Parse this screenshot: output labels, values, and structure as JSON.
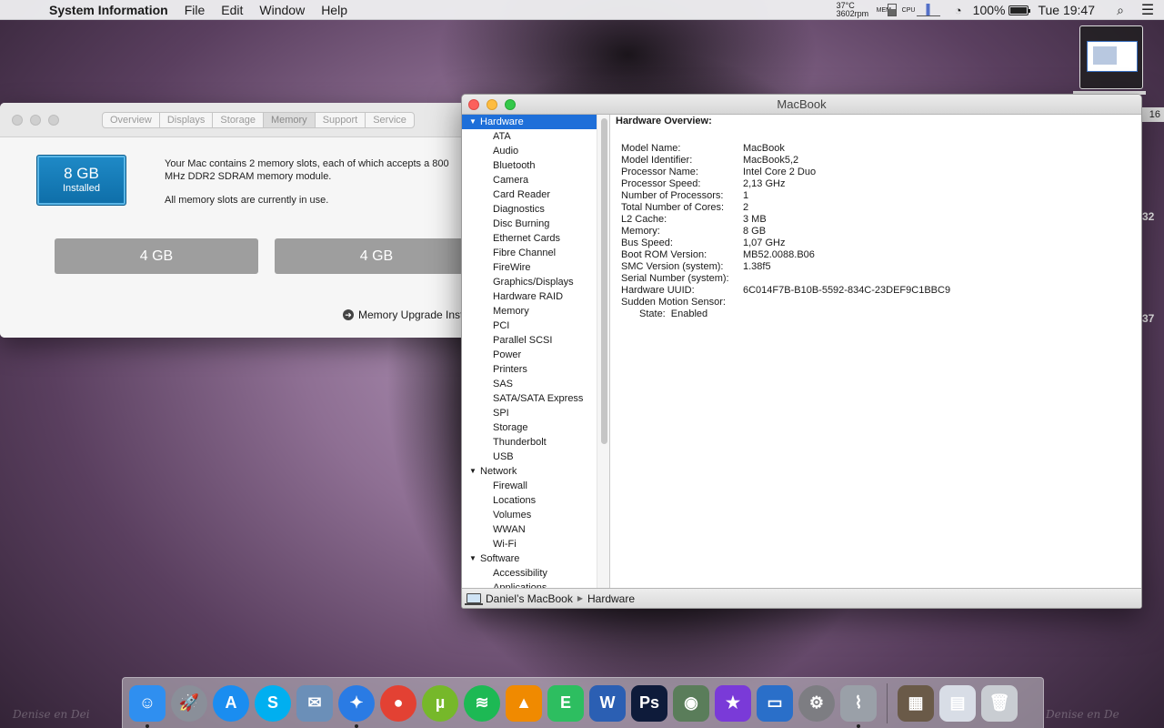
{
  "menubar": {
    "apple": "",
    "app_name": "System Information",
    "menus": [
      "File",
      "Edit",
      "Window",
      "Help"
    ],
    "temperature": "37°C",
    "rpm": "3602rpm",
    "mem_label": "MEM",
    "cpu_label": "CPU",
    "battery_percent": "100%",
    "battery_level": 1.0,
    "clock": "Tue 19:47"
  },
  "about_window": {
    "tabs": [
      "Overview",
      "Displays",
      "Storage",
      "Memory",
      "Support",
      "Service"
    ],
    "active_tab": "Memory",
    "installed_size": "8 GB",
    "installed_label": "Installed",
    "description": "Your Mac contains 2 memory slots, each of which accepts a 800 MHz DDR2 SDRAM memory module.",
    "slots_note": "All memory slots are currently in use.",
    "slots": [
      "4 GB",
      "4 GB"
    ],
    "upgrade_link": "Memory Upgrade Inst"
  },
  "si_window": {
    "title": "MacBook",
    "sidebar": [
      {
        "type": "group",
        "label": "Hardware",
        "selected": true
      },
      {
        "type": "item",
        "label": "ATA"
      },
      {
        "type": "item",
        "label": "Audio"
      },
      {
        "type": "item",
        "label": "Bluetooth"
      },
      {
        "type": "item",
        "label": "Camera"
      },
      {
        "type": "item",
        "label": "Card Reader"
      },
      {
        "type": "item",
        "label": "Diagnostics"
      },
      {
        "type": "item",
        "label": "Disc Burning"
      },
      {
        "type": "item",
        "label": "Ethernet Cards"
      },
      {
        "type": "item",
        "label": "Fibre Channel"
      },
      {
        "type": "item",
        "label": "FireWire"
      },
      {
        "type": "item",
        "label": "Graphics/Displays"
      },
      {
        "type": "item",
        "label": "Hardware RAID"
      },
      {
        "type": "item",
        "label": "Memory"
      },
      {
        "type": "item",
        "label": "PCI"
      },
      {
        "type": "item",
        "label": "Parallel SCSI"
      },
      {
        "type": "item",
        "label": "Power"
      },
      {
        "type": "item",
        "label": "Printers"
      },
      {
        "type": "item",
        "label": "SAS"
      },
      {
        "type": "item",
        "label": "SATA/SATA Express"
      },
      {
        "type": "item",
        "label": "SPI"
      },
      {
        "type": "item",
        "label": "Storage"
      },
      {
        "type": "item",
        "label": "Thunderbolt"
      },
      {
        "type": "item",
        "label": "USB"
      },
      {
        "type": "group",
        "label": "Network",
        "selected": false
      },
      {
        "type": "item",
        "label": "Firewall"
      },
      {
        "type": "item",
        "label": "Locations"
      },
      {
        "type": "item",
        "label": "Volumes"
      },
      {
        "type": "item",
        "label": "WWAN"
      },
      {
        "type": "item",
        "label": "Wi-Fi"
      },
      {
        "type": "group",
        "label": "Software",
        "selected": false
      },
      {
        "type": "item",
        "label": "Accessibility"
      },
      {
        "type": "item",
        "label": "Applications"
      }
    ],
    "overview_heading": "Hardware Overview:",
    "properties": [
      {
        "key": "Model Name:",
        "value": "MacBook"
      },
      {
        "key": "Model Identifier:",
        "value": "MacBook5,2"
      },
      {
        "key": "Processor Name:",
        "value": "Intel Core 2 Duo"
      },
      {
        "key": "Processor Speed:",
        "value": "2,13 GHz"
      },
      {
        "key": "Number of Processors:",
        "value": "1"
      },
      {
        "key": "Total Number of Cores:",
        "value": "2"
      },
      {
        "key": "L2 Cache:",
        "value": "3 MB"
      },
      {
        "key": "Memory:",
        "value": "8 GB"
      },
      {
        "key": "Bus Speed:",
        "value": "1,07 GHz"
      },
      {
        "key": "Boot ROM Version:",
        "value": "MB52.0088.B06"
      },
      {
        "key": "SMC Version (system):",
        "value": "1.38f5"
      },
      {
        "key": "Serial Number (system):",
        "value": ""
      },
      {
        "key": "Hardware UUID:",
        "value": "6C014F7B-B10B-5592-834C-23DEF9C1BBC9"
      },
      {
        "key": "Sudden Motion Sensor:",
        "value": ""
      }
    ],
    "sub_property": {
      "key": "State:",
      "value": "Enabled"
    },
    "breadcrumb": [
      "Daniel’s MacBook",
      "Hardware"
    ]
  },
  "edge_fragments": [
    "16",
    "32",
    "37"
  ],
  "watermark": [
    "Denise en Dei",
    "Denise en De"
  ],
  "dock": [
    {
      "name": "finder",
      "glyph": "☺",
      "color": "#2f8ff0",
      "running": true
    },
    {
      "name": "launchpad",
      "glyph": "🚀",
      "color": "#8a8f99",
      "running": false
    },
    {
      "name": "app-store",
      "glyph": "A",
      "color": "#1a8df0",
      "running": false
    },
    {
      "name": "skype",
      "glyph": "S",
      "color": "#00aff0",
      "running": false
    },
    {
      "name": "mail",
      "glyph": "✉",
      "color": "#6b8fb8",
      "running": false
    },
    {
      "name": "safari",
      "glyph": "✦",
      "color": "#2a7be4",
      "running": true
    },
    {
      "name": "chrome",
      "glyph": "●",
      "color": "#e34133",
      "running": false
    },
    {
      "name": "utorrent",
      "glyph": "µ",
      "color": "#76b82a",
      "running": false
    },
    {
      "name": "spotify",
      "glyph": "≋",
      "color": "#1db954",
      "running": false
    },
    {
      "name": "vlc",
      "glyph": "▲",
      "color": "#f08a00",
      "running": false
    },
    {
      "name": "evernote",
      "glyph": "E",
      "color": "#2dbe60",
      "running": false
    },
    {
      "name": "word",
      "glyph": "W",
      "color": "#2b5fb3",
      "running": false
    },
    {
      "name": "photoshop",
      "glyph": "Ps",
      "color": "#0e1b3a",
      "running": false
    },
    {
      "name": "image-capture",
      "glyph": "◉",
      "color": "#5a7d5a",
      "running": false
    },
    {
      "name": "imovie",
      "glyph": "★",
      "color": "#7a3ad8",
      "running": false
    },
    {
      "name": "keynote",
      "glyph": "▭",
      "color": "#2a6fc9",
      "running": false
    },
    {
      "name": "system-preferences",
      "glyph": "⚙",
      "color": "#7d7d82",
      "running": false
    },
    {
      "name": "system-information",
      "glyph": "⌇",
      "color": "#9aa0a8",
      "running": true
    },
    {
      "name": "downloads-stack",
      "glyph": "▦",
      "color": "#6a5a48",
      "running": false
    },
    {
      "name": "documents-stack",
      "glyph": "▤",
      "color": "#d8dde6",
      "running": false
    },
    {
      "name": "trash",
      "glyph": "🗑",
      "color": "#c9cdd2",
      "running": false
    }
  ]
}
